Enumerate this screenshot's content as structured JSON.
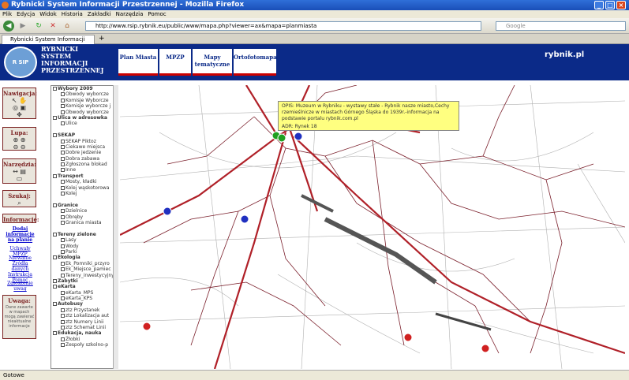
{
  "browser": {
    "title": "Rybnicki System Informacji Przestrzennej - Mozilla Firefox",
    "menu": [
      "Plik",
      "Edycja",
      "Widok",
      "Historia",
      "Zakładki",
      "Narzędzia",
      "Pomoc"
    ],
    "url": "http://www.rsip.rybnik.eu/public/www/mapa.php?viewer=ax&mapa=planmiasta",
    "search_placeholder": "Google",
    "tab": "Rybnicki System Informacji Prz...",
    "status": "Gotowe"
  },
  "header": {
    "system_lines": [
      "RYBNICKI",
      "SYSTEM",
      "INFORMACJI",
      "PRZESTRZENNEJ"
    ],
    "logo_text": "R SIP",
    "tabs": [
      "Plan Miasta",
      "MPZP",
      "Mapy tematyczne",
      "Ortofotomapa"
    ],
    "brand": "rybnik.pl"
  },
  "sidebar": {
    "nav": "Nawigacja:",
    "lupa": "Lupa:",
    "tools": "Narzędzia:",
    "search": "Szukaj:",
    "info": "Informacje:",
    "info_link": "Dodaj informacje na planie",
    "link_mpzp": "Uchwały MPZP",
    "link_sources": "Niewanie Źródła danych Instrukcja Pomoc",
    "link_report": "Zgłoszenie uwag",
    "warn": "Uwaga:",
    "warn_text": "Dane zawarte w mapach mogą zawierać nieaktualne informacje"
  },
  "layers": [
    "Wybory 2009",
    "Obwody wyborcze",
    "Komisje Wyborcze",
    "Komisje wyborcze j",
    "Obwody wyborcze",
    "Ulica w adresowka",
    "Ulice",
    "",
    "SEKAP",
    "SEKAP Piktoz",
    "Ciekawe miejsca",
    "Dobre jedzenie",
    "Dobra zabawa",
    "Zgłoszona blokad",
    "Inne",
    "Transport",
    "Mosty, kładki",
    "Kolej wąskotorowa",
    "Kolej",
    "",
    "Granice",
    "Dzielnice",
    "Obręby",
    "Granica miasta",
    "",
    "Tereny zielone",
    "Lasy",
    "Wody",
    "Parki",
    "Ekologia",
    "Ek_Pomniki_przyro",
    "Ek_Miejsce_pamiec",
    "Tereny_inwestycyjny",
    "Zabytki",
    "eKarta",
    "eKarta_MPS",
    "eKarta_KPS",
    "Autobusy",
    "ztz Przystanek",
    "ztz Lokalizacja aut",
    "ztz Numery Linii",
    "ztz Schemat Linii",
    "Edukacja, nauka",
    "Żłobki",
    "Zespoły szkolno-p"
  ],
  "popup": {
    "opis": "OPIS: Muzeum w Rybniku - wystawy stałe - Rybnik nasze miasto,Cechy rzemieślnicze w miastach Górnego Śląska do 1939r.-informacja na podstawie portalu      rybnik.com.pl",
    "adres": "ADR: Rynek 18"
  }
}
